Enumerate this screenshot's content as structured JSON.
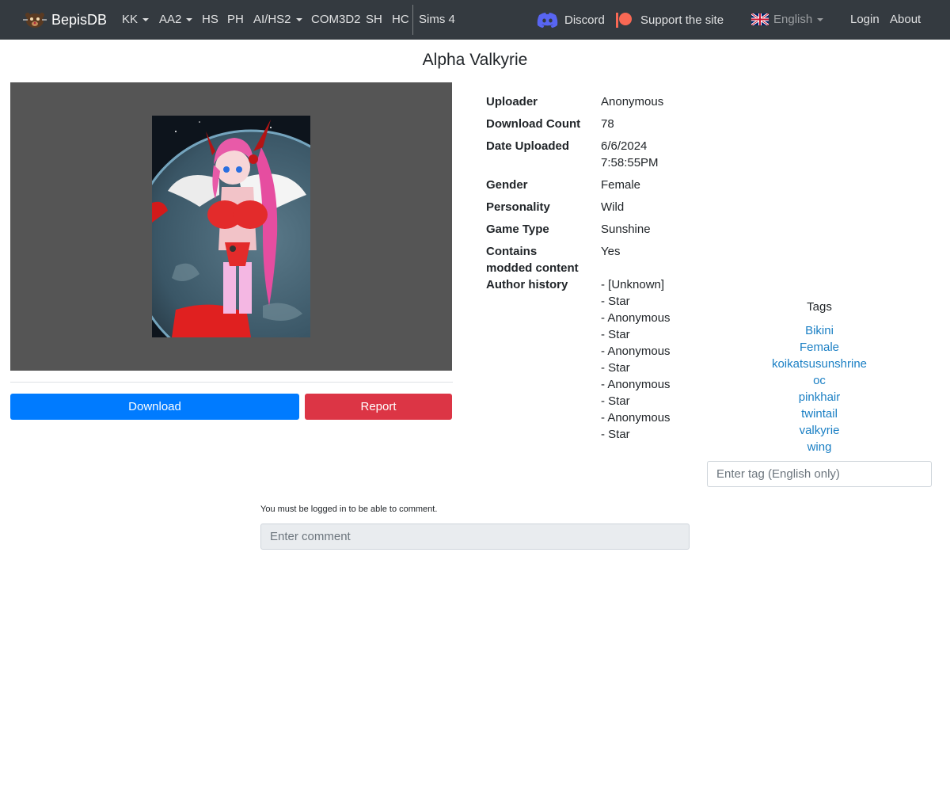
{
  "nav": {
    "brand": "BepisDB",
    "items": [
      {
        "label": "KK",
        "dropdown": true
      },
      {
        "label": "AA2",
        "dropdown": true
      },
      {
        "label": "HS",
        "dropdown": false
      },
      {
        "label": "PH",
        "dropdown": false
      },
      {
        "label": "AI/HS2",
        "dropdown": true
      },
      {
        "label": "COM3D2",
        "dropdown": false
      },
      {
        "label": "SH",
        "dropdown": false
      },
      {
        "label": "HC",
        "dropdown": false
      },
      {
        "label": "Sims 4",
        "dropdown": false
      }
    ],
    "discord": "Discord",
    "support": "Support the site",
    "language": "English",
    "login": "Login",
    "about": "About",
    "colors": {
      "bar": "#343a40",
      "discord": "#5865f2",
      "patreon": "#f96854"
    }
  },
  "card": {
    "title": "Alpha Valkyrie",
    "download_label": "Download",
    "report_label": "Report",
    "info": {
      "uploader_label": "Uploader",
      "uploader": "Anonymous",
      "download_count_label": "Download Count",
      "download_count": "78",
      "date_label": "Date Uploaded",
      "date": "6/6/2024",
      "time": "7:58:55PM",
      "gender_label": "Gender",
      "gender": "Female",
      "personality_label": "Personality",
      "personality": "Wild",
      "game_type_label": "Game Type",
      "game_type": "Sunshine",
      "modded_label_1": "Contains",
      "modded_label_2": "modded content",
      "modded": "Yes",
      "history_label": "Author history",
      "history": [
        "- [Unknown]",
        "- Star",
        "- Anonymous",
        "- Star",
        "- Anonymous",
        "- Star",
        "- Anonymous",
        "- Star",
        "- Anonymous",
        "- Star"
      ]
    }
  },
  "tags": {
    "heading": "Tags",
    "items": [
      "Bikini",
      "Female",
      "koikatsusunshrine",
      "oc",
      "pinkhair",
      "twintail",
      "valkyrie",
      "wing"
    ],
    "input_placeholder": "Enter tag (English only)"
  },
  "comments": {
    "note": "You must be logged in to be able to comment.",
    "placeholder": "Enter comment"
  },
  "colors": {
    "primary": "#007bff",
    "danger": "#dc3545",
    "link": "#1a7fc4",
    "preview_bg": "#555555"
  }
}
